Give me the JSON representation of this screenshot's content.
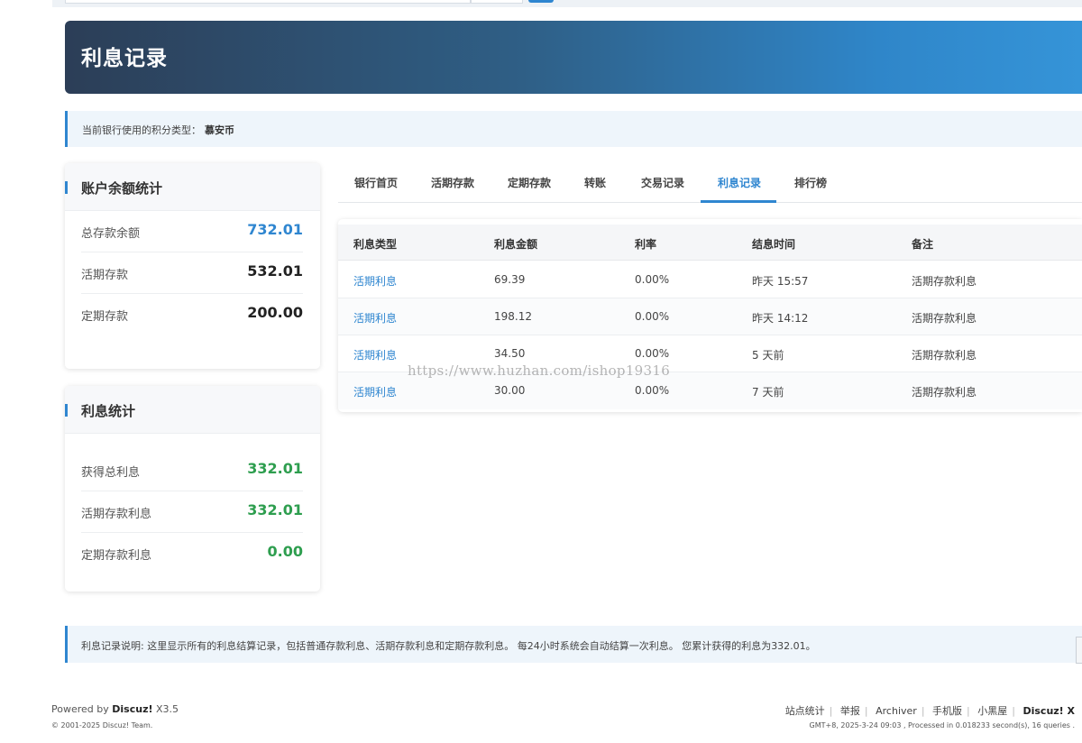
{
  "banner": {
    "title": "利息记录"
  },
  "notice": {
    "label": "当前银行使用的积分类型：",
    "value": "慕安币"
  },
  "balance_card": {
    "title": "账户余额统计",
    "rows": [
      {
        "label": "总存款余额",
        "value": "732.01"
      },
      {
        "label": "活期存款",
        "value": "532.01"
      },
      {
        "label": "定期存款",
        "value": "200.00"
      }
    ]
  },
  "interest_card": {
    "title": "利息统计",
    "rows": [
      {
        "label": "获得总利息",
        "value": "332.01"
      },
      {
        "label": "活期存款利息",
        "value": "332.01"
      },
      {
        "label": "定期存款利息",
        "value": "0.00"
      }
    ]
  },
  "tabs": [
    "银行首页",
    "活期存款",
    "定期存款",
    "转账",
    "交易记录",
    "利息记录",
    "排行榜"
  ],
  "active_tab": "利息记录",
  "table": {
    "headers": [
      "利息类型",
      "利息金额",
      "利率",
      "结息时间",
      "备注"
    ],
    "rows": [
      [
        "活期利息",
        "69.39",
        "0.00%",
        "昨天 15:57",
        "活期存款利息"
      ],
      [
        "活期利息",
        "198.12",
        "0.00%",
        "昨天 14:12",
        "活期存款利息"
      ],
      [
        "活期利息",
        "34.50",
        "0.00%",
        "5 天前",
        "活期存款利息"
      ],
      [
        "活期利息",
        "30.00",
        "0.00%",
        "7 天前",
        "活期存款利息"
      ]
    ]
  },
  "watermark": "https://www.huzhan.com/ishop19316",
  "info": "利息记录说明: 这里显示所有的利息结算记录，包括普通存款利息、活期存款利息和定期存款利息。 每24小时系统会自动结算一次利息。 您累计获得的利息为332.01。",
  "footer": {
    "powered_prefix": "Powered by",
    "brand": "Discuz!",
    "version": "X3.5",
    "copyright": "© 2001-2025 Discuz! Team.",
    "links": [
      "站点统计",
      "举报",
      "Archiver",
      "手机版",
      "小黑屋"
    ],
    "brand_right": "Discuz! X",
    "meta": "GMT+8, 2025-3-24 09:03 , Processed in 0.018233 second(s), 16 queries ."
  },
  "colors": {
    "accent": "#2f86d0",
    "positive": "#2e9e4f"
  }
}
